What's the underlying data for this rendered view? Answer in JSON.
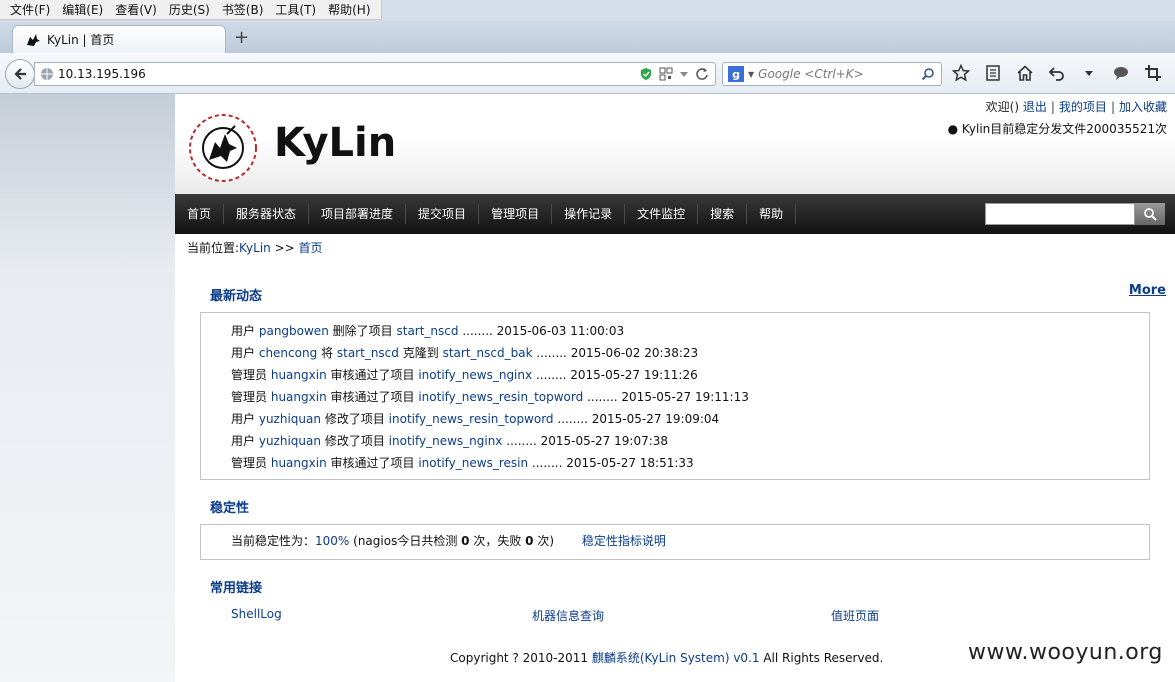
{
  "browser": {
    "menus": [
      "文件(F)",
      "编辑(E)",
      "查看(V)",
      "历史(S)",
      "书签(B)",
      "工具(T)",
      "帮助(H)"
    ],
    "tab_title": "KyLin | 首页",
    "new_tab": "+",
    "url": "10.13.195.196",
    "search_engine": "g",
    "search_placeholder": "Google <Ctrl+K>"
  },
  "header": {
    "brand": "KyLin",
    "logo_text": "KYLIN SYSTEM BY SOGOU OP",
    "welcome": "欢迎()",
    "logout": "退出",
    "my_projects": "我的项目",
    "add_favorite": "加入收藏",
    "notice": "● Kylin目前稳定分发文件200035521次"
  },
  "nav": {
    "items": [
      "首页",
      "服务器状态",
      "项目部署进度",
      "提交项目",
      "管理项目",
      "操作记录",
      "文件监控",
      "搜索",
      "帮助"
    ]
  },
  "breadcrumb": {
    "prefix": "当前位置:",
    "root": "KyLin",
    "sep": " >> ",
    "current": "首页"
  },
  "activity": {
    "title": "最新动态",
    "more": "More",
    "rows": [
      {
        "role": "用户",
        "user": "pangbowen",
        "action": "删除了项目",
        "target": "start_nscd",
        "mid": "",
        "target2": "",
        "time": "........ 2015-06-03 11:00:03"
      },
      {
        "role": "用户",
        "user": "chencong",
        "action": "将",
        "target": "start_nscd",
        "mid": "克隆到",
        "target2": "start_nscd_bak",
        "time": "........ 2015-06-02 20:38:23"
      },
      {
        "role": "管理员",
        "user": "huangxin",
        "action": "审核通过了项目",
        "target": "inotify_news_nginx",
        "mid": "",
        "target2": "",
        "time": "........ 2015-05-27 19:11:26"
      },
      {
        "role": "管理员",
        "user": "huangxin",
        "action": "审核通过了项目",
        "target": "inotify_news_resin_topword",
        "mid": "",
        "target2": "",
        "time": "........ 2015-05-27 19:11:13"
      },
      {
        "role": "用户",
        "user": "yuzhiquan",
        "action": "修改了项目",
        "target": "inotify_news_resin_topword",
        "mid": "",
        "target2": "",
        "time": "........ 2015-05-27 19:09:04"
      },
      {
        "role": "用户",
        "user": "yuzhiquan",
        "action": "修改了项目",
        "target": "inotify_news_nginx",
        "mid": "",
        "target2": "",
        "time": "........ 2015-05-27 19:07:38"
      },
      {
        "role": "管理员",
        "user": "huangxin",
        "action": "审核通过了项目",
        "target": "inotify_news_resin",
        "mid": "",
        "target2": "",
        "time": "........ 2015-05-27 18:51:33"
      }
    ]
  },
  "stability": {
    "title": "稳定性",
    "label": "当前稳定性为：",
    "value": "100%",
    "text1": " (nagios今日共检测 ",
    "checks": "0",
    "text2": " 次，失败 ",
    "fails": "0",
    "text3": " 次)",
    "link": "稳定性指标说明"
  },
  "links": {
    "title": "常用链接",
    "items": [
      "ShellLog",
      "机器信息查询",
      "值班页面"
    ]
  },
  "footer": {
    "text1": "Copyright ? 2010-2011 ",
    "link": "麒麟系统(KyLin System) v0.1",
    "text2": " All Rights Reserved."
  },
  "watermark": "www.wooyun.org"
}
